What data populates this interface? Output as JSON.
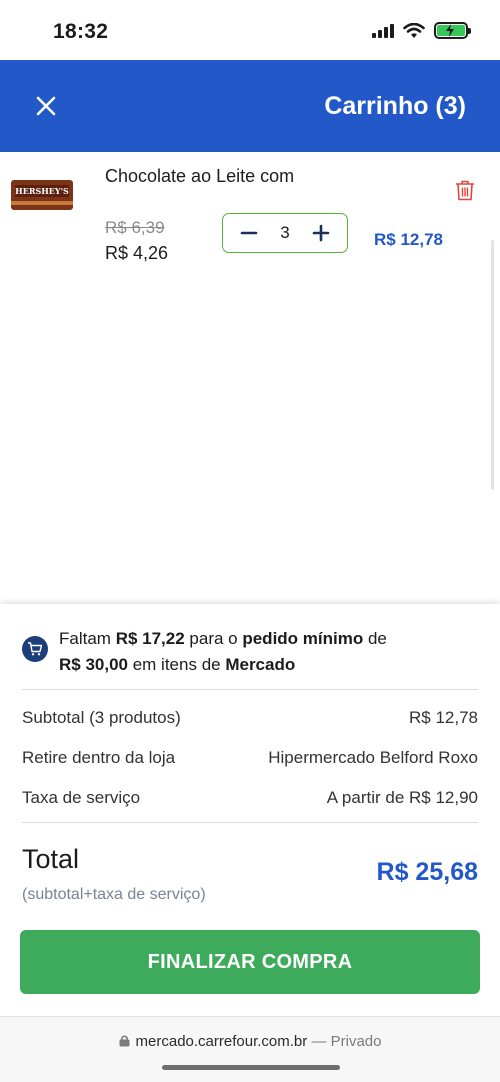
{
  "status_bar": {
    "time": "18:32"
  },
  "header": {
    "title": "Carrinho (3)"
  },
  "item": {
    "image_brand": "HERSHEY'S",
    "name": "Chocolate ao Leite com",
    "old_price": "R$ 6,39",
    "new_price": "R$ 4,26",
    "quantity": "3",
    "line_total": "R$ 12,78"
  },
  "summary": {
    "min_note": {
      "prefix": "Faltam ",
      "missing": "R$ 17,22",
      "middle": " para o ",
      "min_label": "pedido mínimo",
      "after_label": " de",
      "min_value": "R$ 30,00",
      "suffix": " em itens de ",
      "category": "Mercado"
    },
    "rows": [
      {
        "label": "Subtotal (3 produtos)",
        "value": "R$ 12,78"
      },
      {
        "label": "Retire dentro da loja",
        "value": "Hipermercado Belford Roxo"
      },
      {
        "label": "Taxa de serviço",
        "value": "A partir de R$ 12,90"
      }
    ],
    "total_label": "Total",
    "total_note": "(subtotal+taxa de serviço)",
    "total_value": "R$ 25,68",
    "checkout_label": "FINALIZAR COMPRA"
  },
  "browser": {
    "url": "mercado.carrefour.com.br",
    "privacy": "— Privado"
  },
  "colors": {
    "brand_blue": "#2358c8",
    "accent_green": "#3daa5c",
    "stepper_border": "#58b13a",
    "delete_red": "#e2453a"
  },
  "icons": [
    "signal-icon",
    "wifi-icon",
    "battery-charging-icon",
    "close-icon",
    "trash-icon",
    "minus-icon",
    "plus-icon",
    "cart-icon",
    "lock-icon"
  ]
}
